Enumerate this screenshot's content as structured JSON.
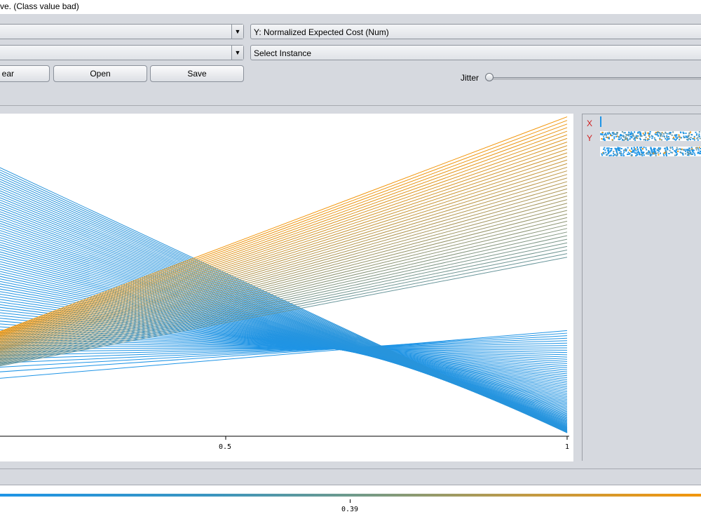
{
  "window": {
    "title": "ve. (Class value bad)"
  },
  "controls": {
    "x_axis_select": {
      "value": ""
    },
    "y_axis_select": {
      "value": "Y: Normalized Expected Cost (Num)"
    },
    "colour_select": {
      "value": ""
    },
    "instance_select": {
      "value": "Select Instance"
    },
    "buttons": {
      "clear": "ear",
      "open": "Open",
      "save": "Save"
    },
    "jitter": {
      "label": "Jitter",
      "value": 0
    }
  },
  "side_panel": {
    "x_label": "X",
    "y_label": "Y"
  },
  "legend": {
    "tick_label": "0.39",
    "color_low": "#1e94e6",
    "color_high": "#f2960c"
  },
  "chart_data": {
    "type": "line",
    "title": "",
    "xlabel": "",
    "ylabel": "",
    "x_ticks": [
      "0.5",
      "1"
    ],
    "xlim": [
      0,
      1
    ],
    "ylim": [
      0,
      1
    ],
    "colors": {
      "low_class": "#1e94e6",
      "high_class": "#f2960c"
    },
    "description_series": "cost curve lines from x=0 to x=1, colored by threshold",
    "blue_lines": {
      "count": 80,
      "y_at_0_range": [
        0.14,
        1.0
      ],
      "y_at_1_range": [
        0.0,
        0.32
      ]
    },
    "orange_lines": {
      "count": 40,
      "y_at_0_range": [
        0.14,
        0.18
      ],
      "y_at_1_range": [
        0.55,
        0.99
      ]
    }
  }
}
